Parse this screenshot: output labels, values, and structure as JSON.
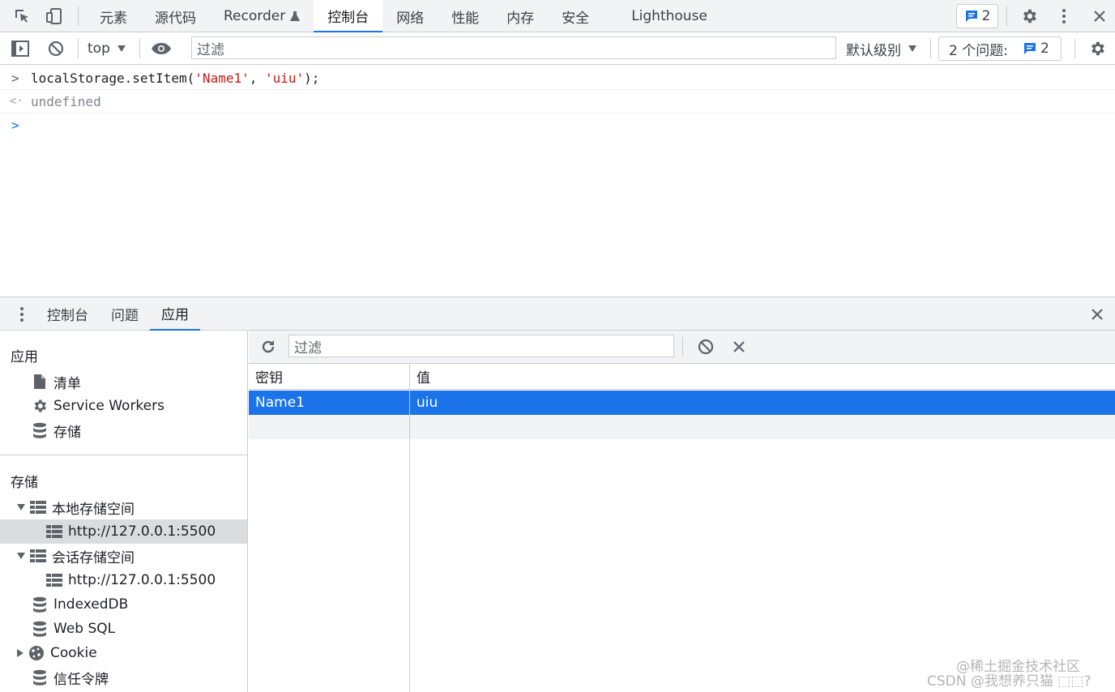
{
  "toptabs": {
    "tabs": [
      "元素",
      "源代码",
      "Recorder",
      "控制台",
      "网络",
      "性能",
      "内存",
      "安全",
      "Lighthouse"
    ],
    "active_index": 3,
    "issues_badge": "2"
  },
  "console_toolbar": {
    "context": "top",
    "filter_placeholder": "过滤",
    "level": "默认级别",
    "issues_label": "2 个问题:",
    "issues_count": "2"
  },
  "console": {
    "lines": [
      {
        "prefix": ">",
        "parts": [
          {
            "text": "localStorage.setItem(",
            "kind": "code"
          },
          {
            "text": "'Name1'",
            "kind": "string"
          },
          {
            "text": ", ",
            "kind": "code"
          },
          {
            "text": "'uiu'",
            "kind": "string"
          },
          {
            "text": ");",
            "kind": "code"
          }
        ]
      },
      {
        "prefix": "<·",
        "parts": [
          {
            "text": "undefined",
            "kind": "result"
          }
        ]
      }
    ],
    "prompt": ">"
  },
  "drawer": {
    "tabs": [
      "控制台",
      "问题",
      "应用"
    ],
    "active_index": 2
  },
  "sidebar": {
    "app_header": "应用",
    "app_items": [
      {
        "label": "清单",
        "icon": "document-icon"
      },
      {
        "label": "Service Workers",
        "icon": "gear-icon"
      },
      {
        "label": "存储",
        "icon": "database-icon"
      }
    ],
    "storage_header": "存储",
    "local_storage": {
      "label": "本地存储空间",
      "child": "http://127.0.0.1:5500"
    },
    "session_storage": {
      "label": "会话存储空间",
      "child": "http://127.0.0.1:5500"
    },
    "storage_items": [
      {
        "label": "IndexedDB",
        "icon": "database-icon"
      },
      {
        "label": "Web SQL",
        "icon": "database-icon"
      },
      {
        "label": "Cookie",
        "icon": "cookie-icon"
      },
      {
        "label": "信任令牌",
        "icon": "database-icon"
      }
    ]
  },
  "storage_panel": {
    "filter_placeholder": "过滤",
    "columns": [
      "密钥",
      "值"
    ],
    "rows": [
      {
        "key": "Name1",
        "value": "uiu"
      }
    ]
  },
  "watermark": {
    "line1": "@稀土掘金技术社区",
    "line2": "CSDN @我想养只猫 ⬚⬚?"
  },
  "colors": {
    "accent": "#1a73e8",
    "toolbar_bg": "#f1f3f4",
    "string": "#c41a16",
    "selected_row": "#1a73e8"
  }
}
